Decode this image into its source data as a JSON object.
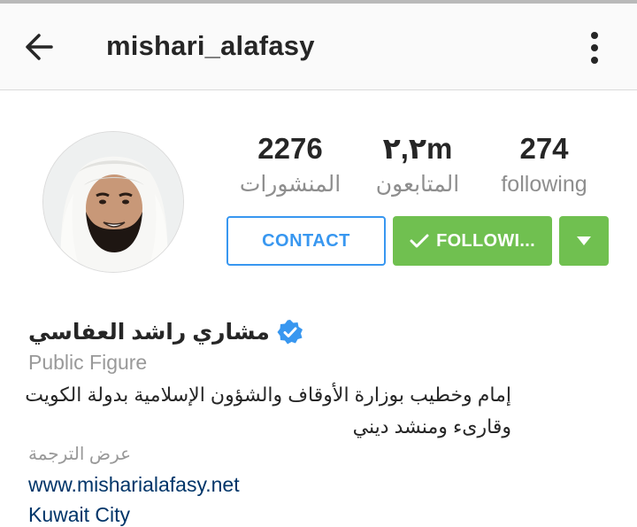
{
  "header": {
    "username": "mishari_alafasy",
    "back_icon": "arrow-left-icon",
    "more_icon": "more-vertical-icon"
  },
  "stats": {
    "posts": {
      "value": "2276",
      "label": "المنشورات"
    },
    "followers": {
      "value": "٢,٢m",
      "label": "المتابعون"
    },
    "following": {
      "value": "274",
      "label": "following"
    }
  },
  "actions": {
    "contact_label": "CONTACT",
    "following_label": "FOLLOWI...",
    "following_icon": "check-icon",
    "dropdown_icon": "triangle-down-icon"
  },
  "profile": {
    "display_name": "مشاري راشد العفاسي",
    "verified_icon": "verified-badge-icon",
    "category": "Public Figure",
    "bio_line1": "إمام وخطيب بوزارة الأوقاف والشؤون الإسلامية بدولة الكويت",
    "bio_line2": "وقارىء ومنشد ديني",
    "translate_label": "عرض الترجمة",
    "website": "www.misharialafasy.net",
    "location": "Kuwait City"
  },
  "colors": {
    "accent_blue": "#3897f0",
    "following_green": "#70c050",
    "link_navy": "#003569",
    "muted_gray": "#8e8e8e"
  }
}
